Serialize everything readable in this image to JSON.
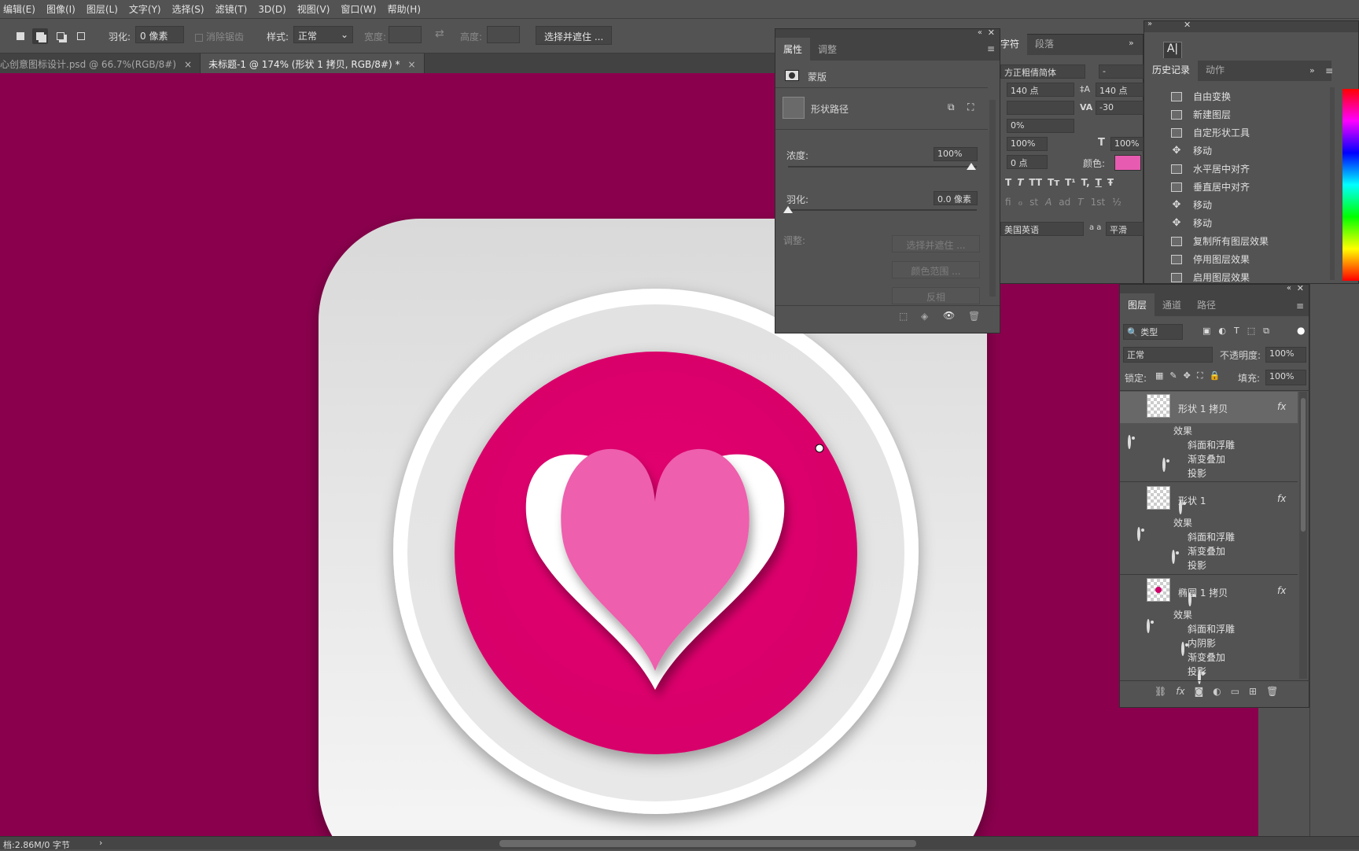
{
  "menu": [
    "编辑(E)",
    "图像(I)",
    "图层(L)",
    "文字(Y)",
    "选择(S)",
    "滤镜(T)",
    "3D(D)",
    "视图(V)",
    "窗口(W)",
    "帮助(H)"
  ],
  "options": {
    "feather_label": "羽化:",
    "feather_value": "0 像素",
    "antialias_label": "消除锯齿",
    "style_label": "样式:",
    "style_value": "正常",
    "width_label": "宽度:",
    "height_label": "高度:",
    "select_mask_button": "选择并遮住 ..."
  },
  "tabs": [
    {
      "title": "心创意图标设计.psd @ 66.7%(RGB/8#)",
      "close": "×"
    },
    {
      "title": "未标题-1 @ 174% (形状 1 拷贝, RGB/8#) *",
      "close": "×"
    }
  ],
  "status": {
    "text": "档:2.86M/0 字节",
    "arrow": "›"
  },
  "properties": {
    "tabs": [
      "属性",
      "调整"
    ],
    "mask_label": "蒙版",
    "shape_path_label": "形状路径",
    "density_label": "浓度:",
    "density_value": "100%",
    "feather_label": "羽化:",
    "feather_value": "0.0 像素",
    "adjust_label": "调整:",
    "select_mask_button": "选择并遮住 ...",
    "color_range_button": "颜色范围 ...",
    "invert_button": "反相",
    "density_percent": 100,
    "feather_percent": 0
  },
  "character": {
    "tabs": [
      "字符",
      "段落"
    ],
    "font": "方正粗倩简体",
    "font_style": "-",
    "size": "140 点",
    "leading": "140 点",
    "tracking": "-30",
    "kerning_pct": "0%",
    "vscale": "100%",
    "hscale": "100%",
    "baseline": "0 点",
    "color_label": "颜色:",
    "color": "#e75bb0",
    "language": "美国英语",
    "aa_label": "a a",
    "aa_value": "平滑",
    "styles": [
      "T",
      "T",
      "TT",
      "Tт",
      "T¹",
      "T,",
      "T",
      "Ŧ"
    ],
    "ot": [
      "ﬁ",
      "ℴ",
      "st",
      "A",
      "ad",
      "T",
      "1st",
      "½"
    ]
  },
  "history": {
    "tabs": [
      "历史记录",
      "动作"
    ],
    "items": [
      {
        "label": "自由变换",
        "icon": "doc"
      },
      {
        "label": "新建图层",
        "icon": "doc"
      },
      {
        "label": "自定形状工具",
        "icon": "doc"
      },
      {
        "label": "移动",
        "icon": "move"
      },
      {
        "label": "水平居中对齐",
        "icon": "doc"
      },
      {
        "label": "垂直居中对齐",
        "icon": "doc"
      },
      {
        "label": "移动",
        "icon": "move"
      },
      {
        "label": "移动",
        "icon": "move"
      },
      {
        "label": "复制所有图层效果",
        "icon": "doc"
      },
      {
        "label": "停用图层效果",
        "icon": "doc"
      },
      {
        "label": "启用图层效果",
        "icon": "doc"
      }
    ]
  },
  "layers": {
    "tabs": [
      "图层",
      "通道",
      "路径"
    ],
    "filter": "类型",
    "blend": "正常",
    "opacity_label": "不透明度:",
    "opacity": "100%",
    "lock_label": "锁定:",
    "fill_label": "填充:",
    "fill": "100%",
    "fx": "fx",
    "effects_label": "效果",
    "items": [
      {
        "name": "形状 1 拷贝",
        "effects": [
          "斜面和浮雕",
          "渐变叠加",
          "投影"
        ]
      },
      {
        "name": "形状 1",
        "effects": [
          "斜面和浮雕",
          "渐变叠加",
          "投影"
        ]
      },
      {
        "name": "椭圆 1 拷贝",
        "effects": [
          "斜面和浮雕",
          "内阴影",
          "渐变叠加",
          "投影"
        ]
      }
    ]
  },
  "colors": {
    "canvas_bg": "#8b004d",
    "circle": "#e0006f",
    "heart_front": "#ee5fad",
    "panel": "#535353"
  }
}
